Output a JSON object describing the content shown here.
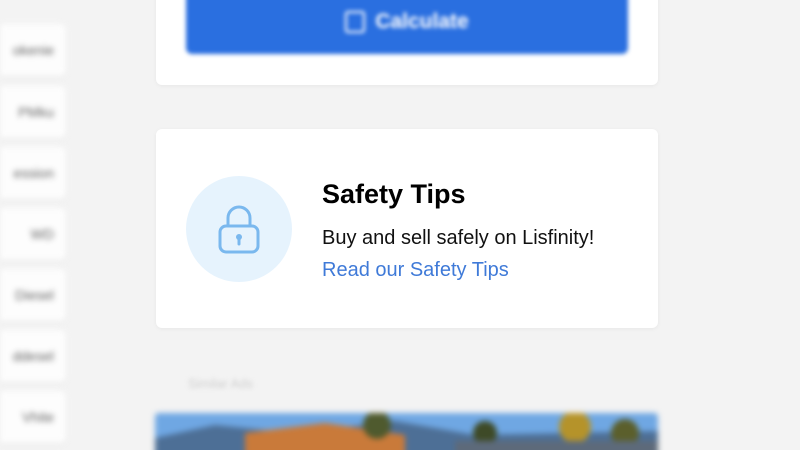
{
  "left_list": {
    "items": [
      {
        "label": "okenie"
      },
      {
        "label": "PMku"
      },
      {
        "label": "ession"
      },
      {
        "label": "WD"
      },
      {
        "label": "Diesel"
      },
      {
        "label": "ddesel"
      },
      {
        "label": "Vhite"
      }
    ]
  },
  "calculator": {
    "button_label": "Calculate",
    "icon": "calculator-icon"
  },
  "safety_tips": {
    "title": "Safety Tips",
    "description": "Buy and sell safely on Lisfinity!",
    "link_text": "Read our Safety Tips",
    "icon": "lock-icon"
  },
  "section": {
    "label": "Similar Ads"
  },
  "colors": {
    "primary_button": "#2a6fe0",
    "link": "#3f7ad8",
    "icon_circle_bg": "#e6f3fd",
    "icon_stroke": "#7ab8ee",
    "page_bg": "#f3f3f3"
  }
}
